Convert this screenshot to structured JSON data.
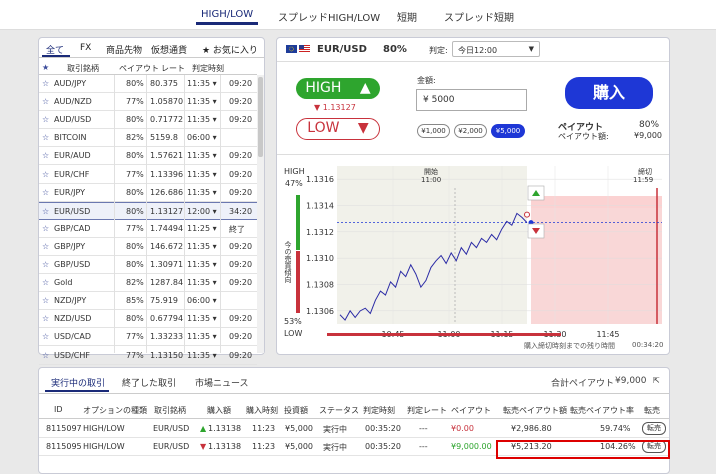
{
  "topnav": {
    "tabs": [
      "HIGH/LOW",
      "スプレッドHIGH/LOW",
      "短期",
      "スプレッド短期"
    ],
    "active_index": 0
  },
  "left": {
    "tabs": [
      "全て",
      "FX",
      "商品先物",
      "仮想通貨",
      "★ お気に入り"
    ],
    "headers": [
      "★",
      "取引銘柄",
      "ペイアウト",
      "レート",
      "判定時刻"
    ],
    "rows": [
      {
        "symbol": "AUD/JPY",
        "payout": "80%",
        "rate": "80.375",
        "time": "11:35",
        "close": "09:20"
      },
      {
        "symbol": "AUD/NZD",
        "payout": "77%",
        "rate": "1.05870",
        "time": "11:35",
        "close": "09:20"
      },
      {
        "symbol": "AUD/USD",
        "payout": "80%",
        "rate": "0.71772",
        "time": "11:35",
        "close": "09:20"
      },
      {
        "symbol": "BITCOIN",
        "payout": "82%",
        "rate": "5159.8",
        "time": "06:00",
        "close": ""
      },
      {
        "symbol": "EUR/AUD",
        "payout": "80%",
        "rate": "1.57621",
        "time": "11:35",
        "close": "09:20"
      },
      {
        "symbol": "EUR/CHF",
        "payout": "77%",
        "rate": "1.13396",
        "time": "11:35",
        "close": "09:20"
      },
      {
        "symbol": "EUR/JPY",
        "payout": "80%",
        "rate": "126.686",
        "time": "11:35",
        "close": "09:20"
      },
      {
        "symbol": "EUR/USD",
        "payout": "80%",
        "rate": "1.13127",
        "time": "12:00",
        "close": "34:20"
      },
      {
        "symbol": "GBP/CAD",
        "payout": "77%",
        "rate": "1.74494",
        "time": "11:25",
        "close": "終了"
      },
      {
        "symbol": "GBP/JPY",
        "payout": "80%",
        "rate": "146.672",
        "time": "11:35",
        "close": "09:20"
      },
      {
        "symbol": "GBP/USD",
        "payout": "80%",
        "rate": "1.30971",
        "time": "11:35",
        "close": "09:20"
      },
      {
        "symbol": "Gold",
        "payout": "82%",
        "rate": "1287.84",
        "time": "11:35",
        "close": "09:20"
      },
      {
        "symbol": "NZD/JPY",
        "payout": "85%",
        "rate": "75.919",
        "time": "06:00",
        "close": ""
      },
      {
        "symbol": "NZD/USD",
        "payout": "80%",
        "rate": "0.67794",
        "time": "11:35",
        "close": "09:20"
      },
      {
        "symbol": "USD/CAD",
        "payout": "77%",
        "rate": "1.33233",
        "time": "11:35",
        "close": "09:20"
      },
      {
        "symbol": "USD/CHF",
        "payout": "77%",
        "rate": "1.13150",
        "time": "11:35",
        "close": "09:20"
      }
    ],
    "selected_index": 7
  },
  "trade": {
    "pair": "EUR/USD",
    "payout_pct": "80%",
    "judge_label": "判定:",
    "judge_value": "今日12:00",
    "high_label": "HIGH",
    "high_arrow": "▲",
    "low_label": "LOW",
    "low_arrow": "▼",
    "current_rate": "▼ 1.13127",
    "amount_label": "金額:",
    "amount_value": "¥ 5000",
    "chips": [
      "¥1,000",
      "¥2,000",
      "¥5,000"
    ],
    "active_chip": 2,
    "buy_label": "購入",
    "payout_label": "ペイアウト",
    "payout_value": "80%",
    "payout_amount_label": "ペイアウト額:",
    "payout_amount_value": "¥9,000",
    "colors": {
      "high": "#2ea52e",
      "low": "#c8323c",
      "buy": "#1e37d6"
    }
  },
  "chart": {
    "high_label": "HIGH",
    "high_pct": "47%",
    "low_label": "LOW",
    "low_pct": "53%",
    "side_label": "今の売買傾向",
    "open_label": "開始",
    "open_time": "11:00",
    "close_label": "締切",
    "close_time": "11:59",
    "remaining_label": "購入締切時刻までの残り時間",
    "remaining_value": "00:34:20"
  },
  "chart_data": {
    "type": "line",
    "x_ticks": [
      "10:45",
      "11:00",
      "11:15",
      "11:30",
      "11:45"
    ],
    "y_ticks": [
      "1.1316",
      "1.1314",
      "1.1312",
      "1.1310",
      "1.1308",
      "1.1306"
    ],
    "ylim": [
      1.1305,
      1.1317
    ],
    "current_rate": 1.13127,
    "series": [
      {
        "values": [
          1.13057,
          1.13053,
          1.1306,
          1.13055,
          1.1306,
          1.13062,
          1.13058,
          1.13068,
          1.13075,
          1.13072,
          1.13082,
          1.13078,
          1.1309,
          1.13086,
          1.13095,
          1.13088,
          1.13078,
          1.13083,
          1.13093,
          1.13098,
          1.13102,
          1.13096,
          1.13104,
          1.13098,
          1.13108,
          1.13103,
          1.13112,
          1.13108,
          1.13115,
          1.13112,
          1.13118,
          1.13114,
          1.13122,
          1.13128,
          1.13125,
          1.13134,
          1.13131,
          1.13127
        ]
      }
    ]
  },
  "bottom": {
    "tabs": [
      "実行中の取引",
      "終了した取引",
      "市場ニュース"
    ],
    "total_payout_label": "合計ペイアウト",
    "total_payout_value": "¥9,000",
    "headers": [
      "ID",
      "オプションの種類",
      "取引銘柄",
      "購入額",
      "購入時刻",
      "投資額",
      "ステータス",
      "判定時刻",
      "判定レート",
      "ペイアウト",
      "転売ペイアウト額",
      "転売ペイアウト率",
      "転売"
    ],
    "rows": [
      {
        "id": "8115097",
        "type": "HIGH/LOW",
        "symbol": "EUR/USD",
        "dir": "up",
        "price": "1.13138",
        "time": "11:23",
        "invest": "¥5,000",
        "status": "実行中",
        "judge": "00:35:20",
        "rate": "---",
        "payout": "¥0.00",
        "resale": "¥2,986.80",
        "resale_pct": "59.74%",
        "sell": "転売"
      },
      {
        "id": "8115095",
        "type": "HIGH/LOW",
        "symbol": "EUR/USD",
        "dir": "down",
        "price": "1.13138",
        "time": "11:23",
        "invest": "¥5,000",
        "status": "実行中",
        "judge": "00:35:20",
        "rate": "---",
        "payout": "¥9,000.00",
        "resale": "¥5,213.20",
        "resale_pct": "104.26%",
        "sell": "転売"
      }
    ]
  }
}
